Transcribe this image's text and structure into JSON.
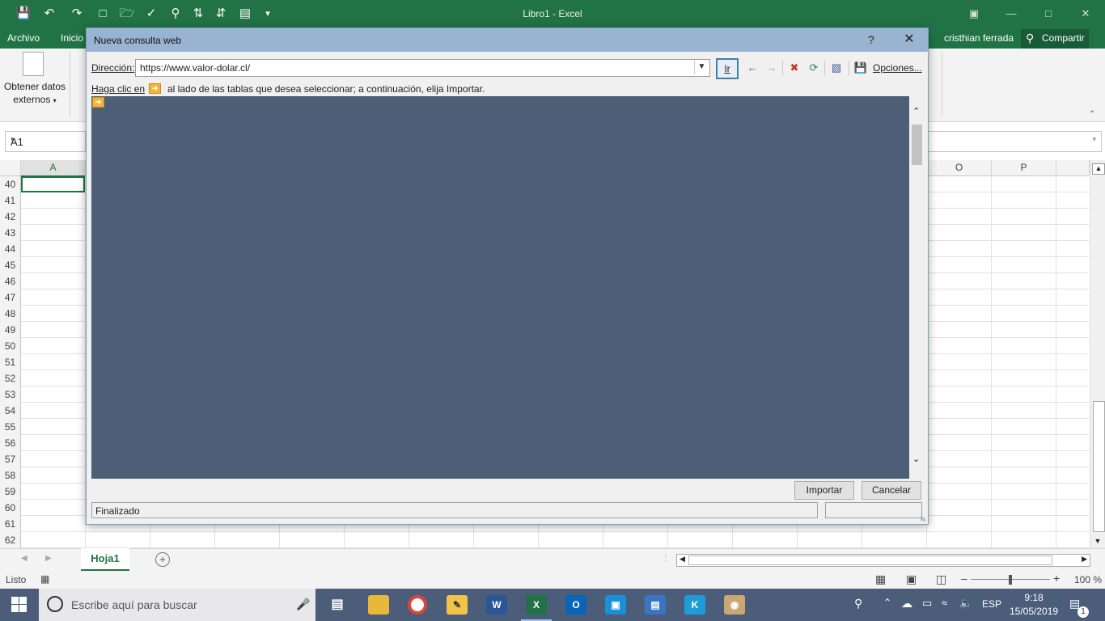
{
  "window": {
    "title": "Libro1 - Excel",
    "user": "cristhian ferrada",
    "share_label": "Compartir"
  },
  "menu": {
    "file": "Archivo",
    "home": "Inicio"
  },
  "ribbon": {
    "get_external_data_line1": "Obtener datos",
    "get_external_data_line2": "externos"
  },
  "formula_bar": {
    "name_box": "A1"
  },
  "grid": {
    "columns_left": [
      "A"
    ],
    "columns_right": [
      "O",
      "P"
    ],
    "rows": [
      "40",
      "41",
      "42",
      "43",
      "44",
      "45",
      "46",
      "47",
      "48",
      "49",
      "50",
      "51",
      "52",
      "53",
      "54",
      "55",
      "56",
      "57",
      "58",
      "59",
      "60",
      "61",
      "62"
    ]
  },
  "sheets": {
    "active": "Hoja1"
  },
  "status_bar": {
    "state": "Listo",
    "zoom": "100 %"
  },
  "taskbar": {
    "search_placeholder": "Escribe aquí para buscar",
    "language": "ESP",
    "time": "9:18",
    "date": "15/05/2019",
    "notifications": "1"
  },
  "dialog": {
    "title": "Nueva consulta web",
    "help": "?",
    "close": "✕",
    "address_label": "Dirección:",
    "address_value": "https://www.valor-dolar.cl/",
    "go_label": "Ir",
    "options_label": "Opciones...",
    "hint_prefix": "Haga clic en",
    "hint_suffix": "al lado de las tablas que desea seleccionar; a continuación, elija Importar.",
    "import_label": "Importar",
    "cancel_label": "Cancelar",
    "status": "Finalizado"
  },
  "colors": {
    "excel_green": "#217346",
    "dialog_title": "#99b4d1",
    "webview_bg": "#4c5f77",
    "taskbar": "#4b5d79"
  }
}
